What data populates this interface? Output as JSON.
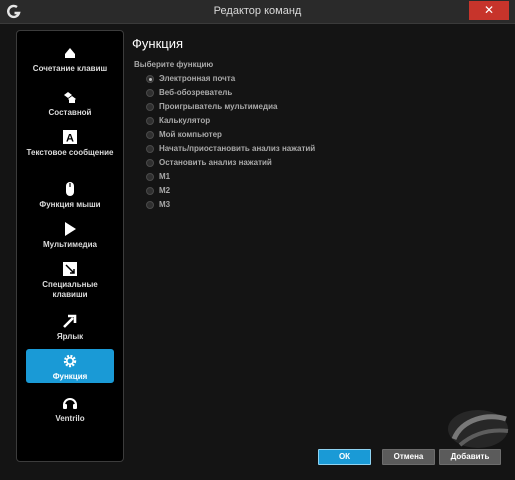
{
  "window": {
    "title": "Редактор команд",
    "close_label": "✕"
  },
  "sidebar": {
    "items": [
      {
        "label": "Сочетание клавиш",
        "icon": "keyboard-mouse-icon"
      },
      {
        "label": "Составной",
        "icon": "multikey-icon"
      },
      {
        "label": "Текстовое сообщение",
        "icon": "text-block-icon"
      },
      {
        "label": "Функция мыши",
        "icon": "mouse-icon"
      },
      {
        "label": "Мультимедиа",
        "icon": "play-icon"
      },
      {
        "label": "Специальные клавиши",
        "icon": "special-key-icon"
      },
      {
        "label": "Ярлык",
        "icon": "shortcut-arrow-icon"
      },
      {
        "label": "Функция",
        "icon": "gear-icon",
        "active": true
      },
      {
        "label": "Ventrilo",
        "icon": "headset-icon"
      }
    ]
  },
  "main": {
    "title": "Функция",
    "group_label": "Выберите функцию",
    "options": [
      {
        "label": "Электронная почта",
        "selected": true
      },
      {
        "label": "Веб-обозреватель",
        "selected": false
      },
      {
        "label": "Проигрыватель мультимедиа",
        "selected": false
      },
      {
        "label": "Калькулятор",
        "selected": false
      },
      {
        "label": "Мой компьютер",
        "selected": false
      },
      {
        "label": "Начать/приостановить анализ нажатий",
        "selected": false
      },
      {
        "label": "Остановить анализ нажатий",
        "selected": false
      },
      {
        "label": "M1",
        "selected": false
      },
      {
        "label": "M2",
        "selected": false
      },
      {
        "label": "M3",
        "selected": false
      }
    ]
  },
  "buttons": {
    "ok": "ОК",
    "cancel": "Отмена",
    "add": "Добавить"
  },
  "colors": {
    "accent": "#1a9ad6",
    "close": "#c7342b"
  }
}
